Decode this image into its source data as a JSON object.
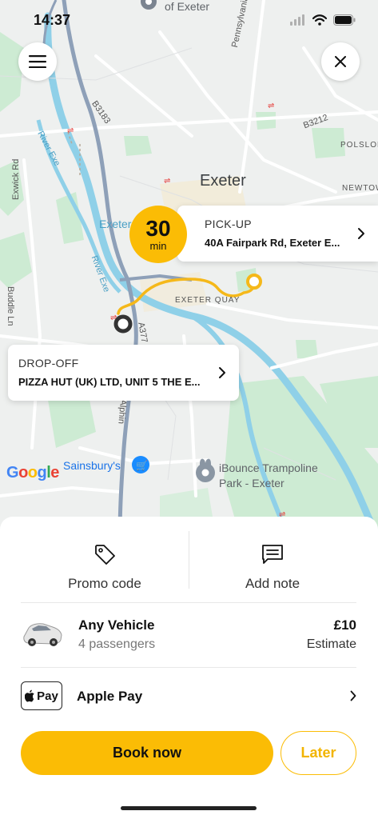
{
  "status": {
    "time": "14:37"
  },
  "map": {
    "labels": {
      "city": "Exeter",
      "top_poi": "of Exeter",
      "pennsylvania": "Pennsylvania Rd",
      "b3183": "B3183",
      "b3212": "B3212",
      "river_exe_1": "River Exe",
      "river_exe_2": "River Exe",
      "exwick": "Exwick Rd",
      "exeter_small": "Exeter",
      "polsloe": "POLSLOE",
      "newtown": "NEWTOWN",
      "exeter_quay": "EXETER QUAY",
      "buddle": "Buddle Ln",
      "a377": "A377",
      "alphington": "Alphin",
      "sainsburys": "Sainsbury's",
      "ibounce_1": "iBounce Trampoline",
      "ibounce_2": "Park - Exeter"
    },
    "google": "Google"
  },
  "eta": {
    "value": "30",
    "unit": "min"
  },
  "pickup": {
    "label": "PICK-UP",
    "address": "40A Fairpark Rd, Exeter E..."
  },
  "dropoff": {
    "label": "DROP-OFF",
    "address": "PIZZA HUT (UK) LTD, UNIT 5 THE E..."
  },
  "options": {
    "promo": "Promo code",
    "note": "Add note"
  },
  "vehicle": {
    "name": "Any Vehicle",
    "passengers": "4 passengers",
    "price": "£10",
    "estimate": "Estimate"
  },
  "payment": {
    "badge": "Pay",
    "method": "Apple Pay"
  },
  "actions": {
    "book": "Book now",
    "later": "Later"
  },
  "colors": {
    "accent": "#fbbc05",
    "route": "#f5b81a",
    "river": "#8fd0e8",
    "park": "#cdebd3",
    "road_main": "#8ea0b8"
  }
}
